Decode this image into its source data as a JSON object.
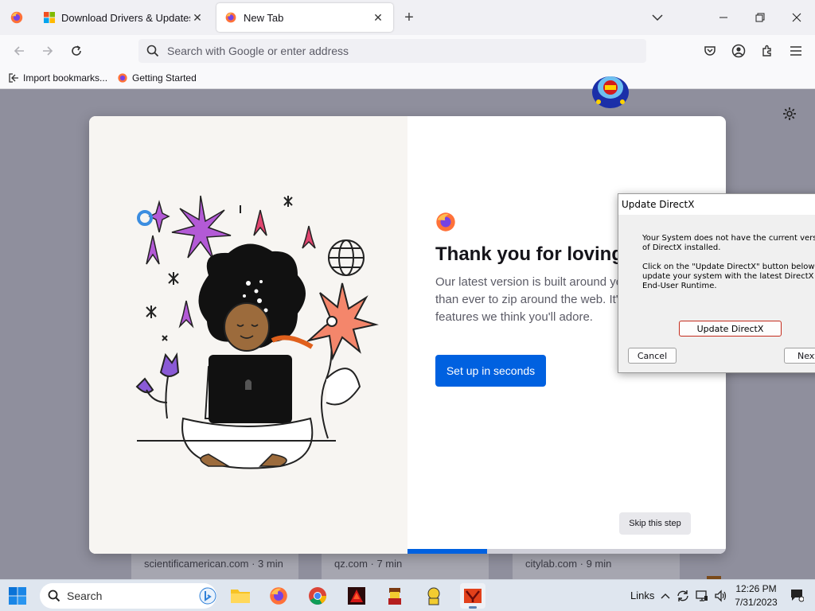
{
  "browser": {
    "tabs": [
      {
        "title": "Download Drivers & Updates for Microsoft, Windows and more - Microsoft Download Center",
        "active": false
      },
      {
        "title": "New Tab",
        "active": true
      }
    ],
    "urlbar_placeholder": "Search with Google or enter address",
    "bookmarks": [
      {
        "label": "Import bookmarks..."
      },
      {
        "label": "Getting Started"
      }
    ]
  },
  "onboarding": {
    "title": "Thank you for loving Firefox",
    "body": "Our latest version is built around you, making it easier than ever to zip around the web. It's packed with features we think you'll adore.",
    "cta": "Set up in seconds",
    "skip": "Skip this step",
    "progress": 0.25
  },
  "topsites": [
    {
      "label": "scientificamerican.com · 3 min"
    },
    {
      "label": "qz.com · 7 min"
    },
    {
      "label": "citylab.com · 9 min"
    }
  ],
  "dialog": {
    "title": "Update DirectX",
    "message": "Your System does not have the current version of DirectX installed.\n\nClick on the \"Update DirectX\" button below and update your system with the latest DirectX End-User Runtime.",
    "update_button": "Update DirectX",
    "cancel_button": "Cancel",
    "next_button": "Next"
  },
  "taskbar": {
    "search_placeholder": "Search",
    "links_label": "Links",
    "time": "12:26 PM",
    "date": "7/31/2023"
  },
  "colors": {
    "accent": "#0061e0",
    "content_bg": "#8f8f9d",
    "dialog_highlight": "#c42b1c"
  }
}
